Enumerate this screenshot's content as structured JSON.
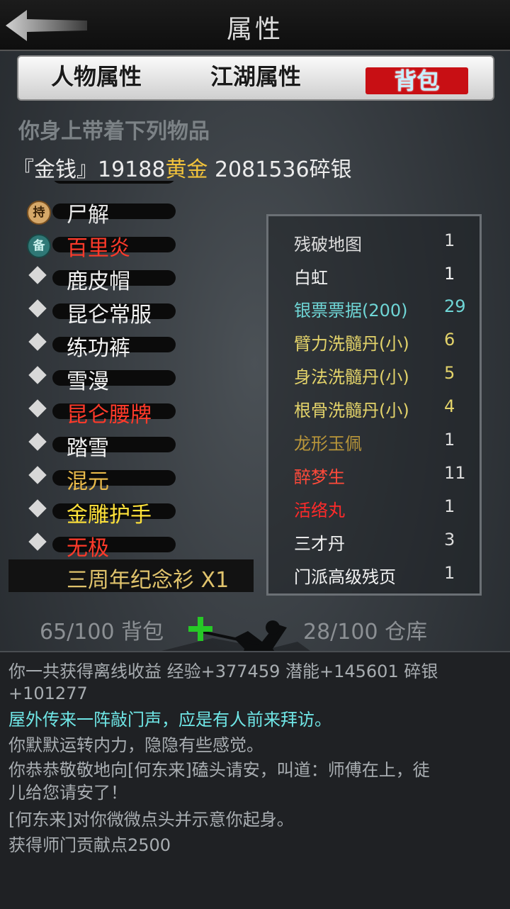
{
  "header": {
    "title": "属性"
  },
  "tabs": [
    {
      "label": "人物属性"
    },
    {
      "label": "江湖属性"
    },
    {
      "label": "背包"
    }
  ],
  "subtitle": "你身上带着下列物品",
  "money": {
    "prefix": "『金钱』",
    "gold_amount": "19188",
    "gold_unit": "黄金",
    "silver_text": " 2081536碎银"
  },
  "left_items": [
    {
      "label": "尸解",
      "color": "#e8e8e8",
      "badge": "持"
    },
    {
      "label": "百里炎",
      "color": "#ff3a2a",
      "badge": "备"
    },
    {
      "label": "鹿皮帽",
      "color": "#f2f2f2"
    },
    {
      "label": "昆仑常服",
      "color": "#f2f2f2"
    },
    {
      "label": "练功裤",
      "color": "#f2f2f2"
    },
    {
      "label": "雪漫",
      "color": "#f2f2f2"
    },
    {
      "label": "昆仑腰牌",
      "color": "#ff3a2a"
    },
    {
      "label": "踏雪",
      "color": "#f2f2f2"
    },
    {
      "label": "混元",
      "color": "#e8b94a"
    },
    {
      "label": "金雕护手",
      "color": "#ffe23a"
    },
    {
      "label": "无极",
      "color": "#ff3a2a"
    }
  ],
  "selected_item": {
    "label": "三周年纪念衫 X1"
  },
  "right_items": [
    {
      "name": "残破地图",
      "qty": "1",
      "color": "#dcdcdc"
    },
    {
      "name": "白虹",
      "qty": "1",
      "color": "#f2f2f2"
    },
    {
      "name": "银票票据(200)",
      "qty": "29",
      "color": "#6fd6d6"
    },
    {
      "name": "臂力洗髓丹(小)",
      "qty": "6",
      "color": "#e3d36a"
    },
    {
      "name": "身法洗髓丹(小)",
      "qty": "5",
      "color": "#e3d36a"
    },
    {
      "name": "根骨洗髓丹(小)",
      "qty": "4",
      "color": "#e3d36a"
    },
    {
      "name": "龙形玉佩",
      "qty": "1",
      "color": "#b9963a"
    },
    {
      "name": "醉梦生",
      "qty": "11",
      "color": "#ff4a3a"
    },
    {
      "name": "活络丸",
      "qty": "1",
      "color": "#ff2a2a"
    },
    {
      "name": "三才丹",
      "qty": "3",
      "color": "#f2f2f2"
    },
    {
      "name": "门派高级残页",
      "qty": "1",
      "color": "#f2f2f2"
    }
  ],
  "bag_count": "65/100 背包",
  "storage_count": "28/100 仓库",
  "log": [
    {
      "text": "你一共获得离线收益 经验+377459 潜能+145601 碎银",
      "style": "normal"
    },
    {
      "text": "+101277",
      "style": "normal"
    },
    {
      "text": "屋外传来一阵敲门声，应是有人前来拜访。",
      "style": "cyan"
    },
    {
      "text": "你默默运转内力，隐隐有些感觉。",
      "style": "normal"
    },
    {
      "text": "你恭恭敬敬地向[何东来]磕头请安，叫道：师傅在上，徒",
      "style": "normal"
    },
    {
      "text": "儿给您请安了！",
      "style": "normal"
    },
    {
      "text": "[何东来]对你微微点头并示意你起身。",
      "style": "normal"
    },
    {
      "text": "获得师门贡献点2500",
      "style": "normal"
    }
  ]
}
